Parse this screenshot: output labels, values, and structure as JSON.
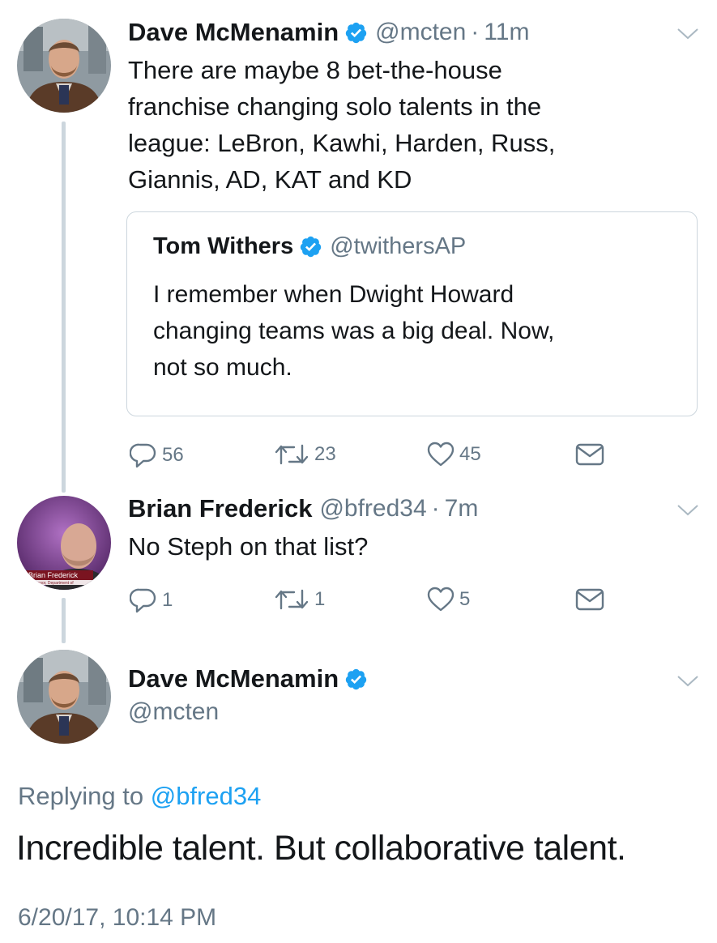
{
  "tweet1": {
    "name": "Dave McMenamin",
    "handle": "@mcten",
    "separator": "·",
    "time": "11m",
    "lines": [
      "There are maybe 8 bet-the-house",
      "franchise changing solo talents in the",
      "league: LeBron, Kawhi, Harden, Russ,",
      "Giannis, AD, KAT and KD"
    ],
    "quote": {
      "name": "Tom Withers",
      "handle": "@twithersAP",
      "lines": [
        "I remember when Dwight Howard",
        "changing teams was a big deal. Now,",
        "not so much."
      ]
    },
    "actions": {
      "replies": "56",
      "retweets": "23",
      "likes": "45"
    }
  },
  "tweet2": {
    "name": "Brian Frederick",
    "handle": "@bfred34",
    "separator": "·",
    "time": "7m",
    "text": "No Steph on that list?",
    "avatar_caption": "Brian Frederick",
    "avatar_subcaption": "Professor, Department of",
    "actions": {
      "replies": "1",
      "retweets": "1",
      "likes": "5"
    }
  },
  "focused": {
    "name": "Dave McMenamin",
    "handle": "@mcten",
    "replying_prefix": "Replying to",
    "replying_to": "@bfred34",
    "text": "Incredible talent. But collaborative talent.",
    "timestamp": "6/20/17, 10:14 PM"
  },
  "icons": {
    "verified": "verified-badge-icon",
    "reply": "reply-bubble-icon",
    "retweet": "retweet-arrows-icon",
    "like": "heart-icon",
    "dm": "envelope-icon",
    "menu": "chevron-down-icon"
  },
  "colors": {
    "verified": "#1da1f2",
    "secondary": "#657786",
    "link": "#1da1f2",
    "thread_line": "#ccd6dd"
  }
}
